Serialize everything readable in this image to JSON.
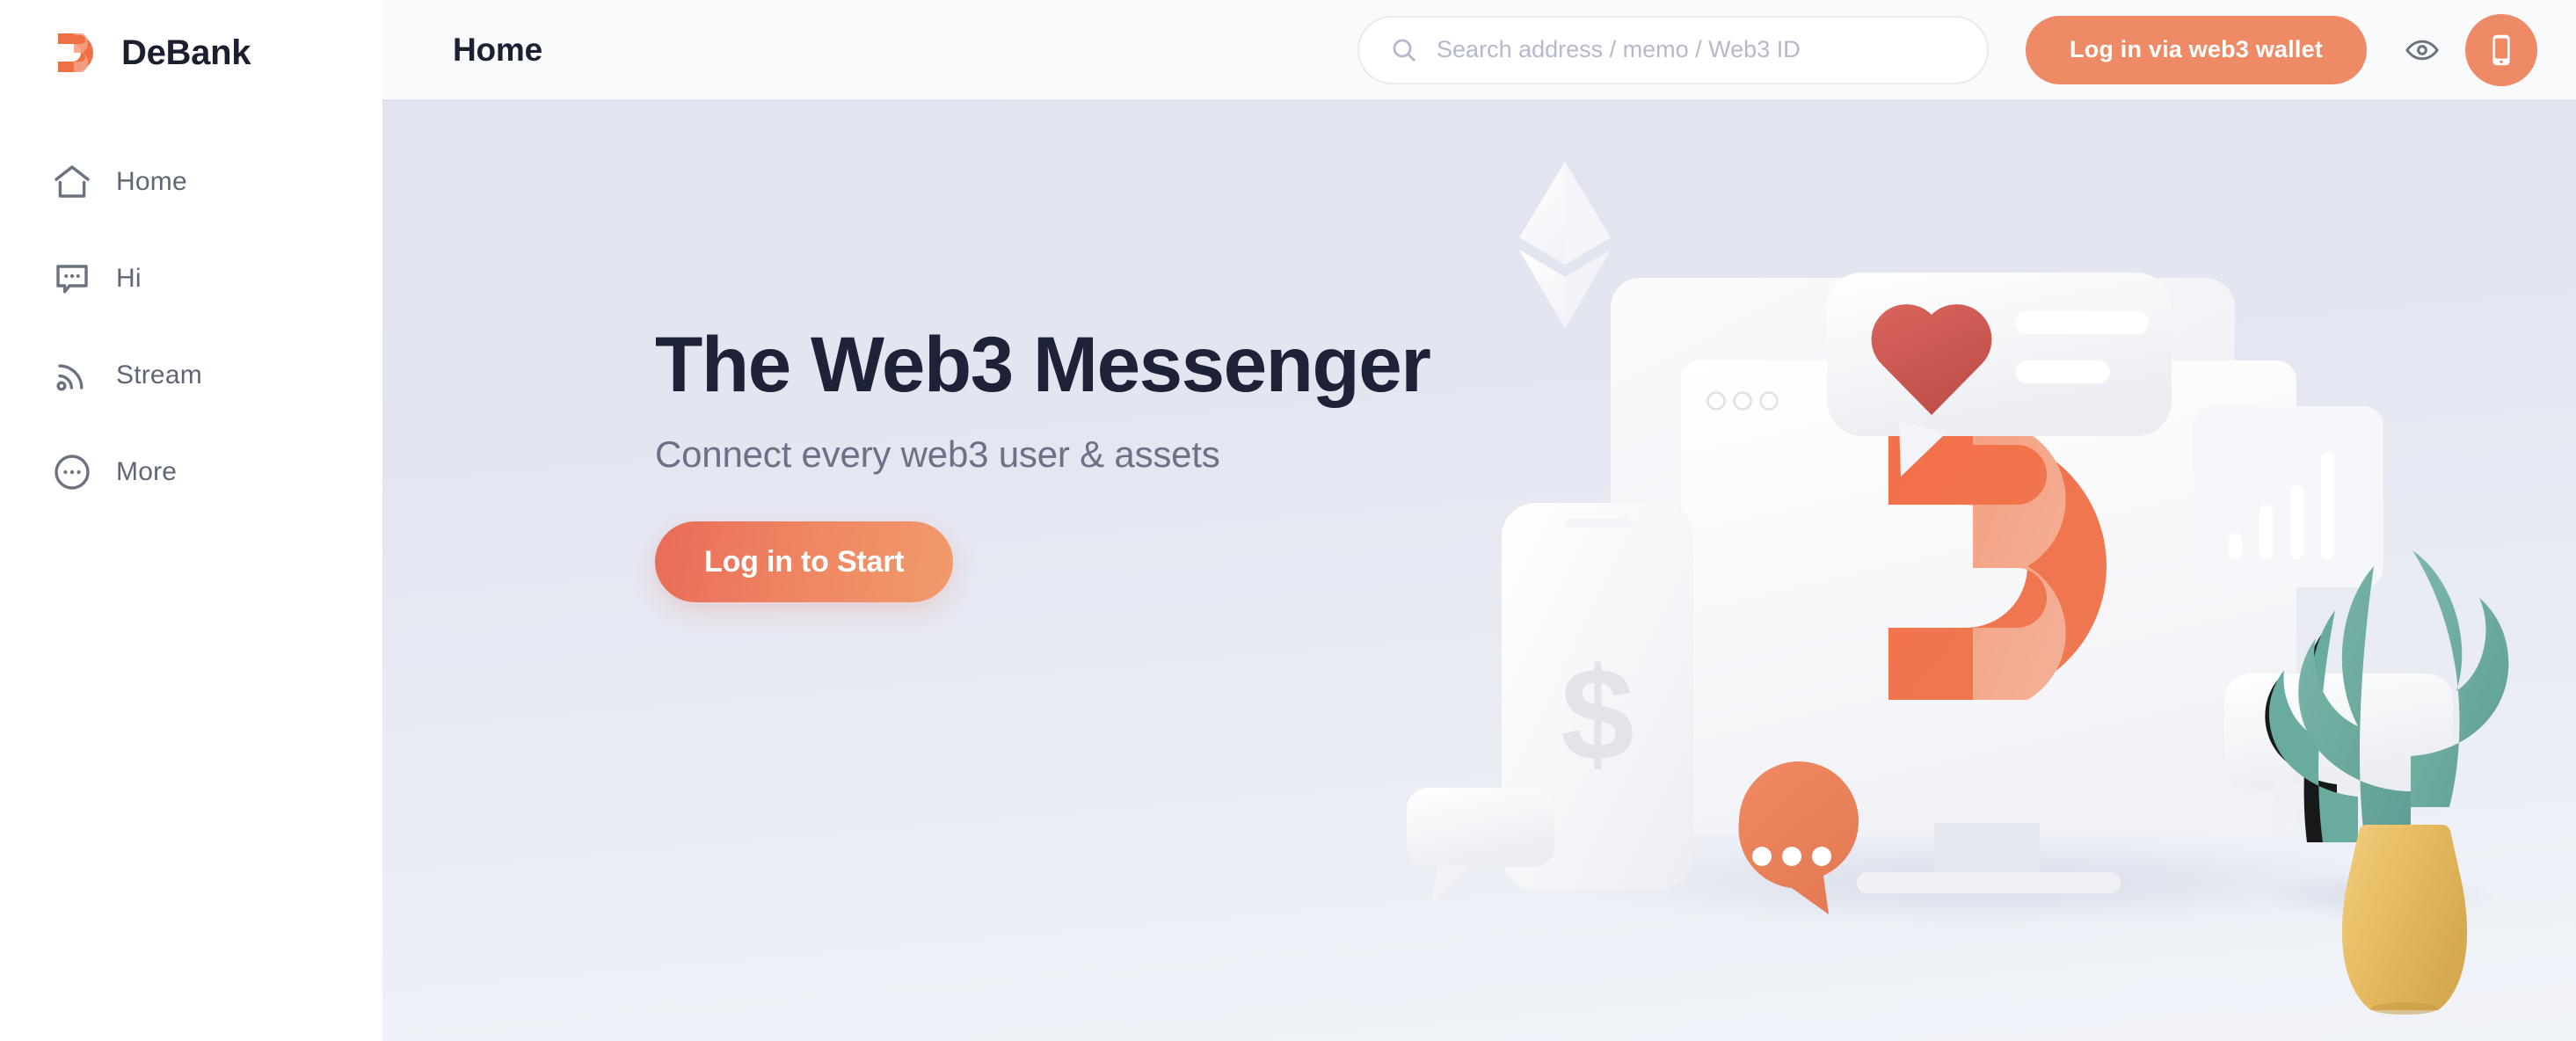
{
  "brand": {
    "name": "DeBank",
    "logo_icon": "debank-logo-icon"
  },
  "sidebar": {
    "items": [
      {
        "label": "Home",
        "icon": "home-icon"
      },
      {
        "label": "Hi",
        "icon": "chat-bubble-icon"
      },
      {
        "label": "Stream",
        "icon": "stream-rss-icon"
      },
      {
        "label": "More",
        "icon": "more-circle-icon"
      }
    ]
  },
  "header": {
    "title": "Home",
    "search": {
      "placeholder": "Search address / memo / Web3 ID",
      "value": "",
      "icon": "search-icon"
    },
    "login_button": "Log in via web3 wallet",
    "eye_icon": "eye-icon",
    "mobile_icon": "mobile-phone-icon"
  },
  "hero": {
    "title": "The Web3 Messenger",
    "subtitle": "Connect every web3 user & assets",
    "cta_label": "Log in to Start",
    "illustration": "web3-messenger-3d-illustration"
  },
  "colors": {
    "accent_orange": "#ee8a66",
    "cta_gradient_start": "#e96c59",
    "cta_gradient_end": "#f19b6c",
    "title_dark": "#1d2239",
    "muted_text": "#6b7288",
    "hero_bg_top": "#e1e4f0",
    "hero_bg_bottom": "#f0f3f8",
    "topbar_bg": "#f9fafb",
    "heart_red": "#cf5b54",
    "plant_green": "#67ab9f",
    "vase_yellow": "#e9bf66"
  }
}
